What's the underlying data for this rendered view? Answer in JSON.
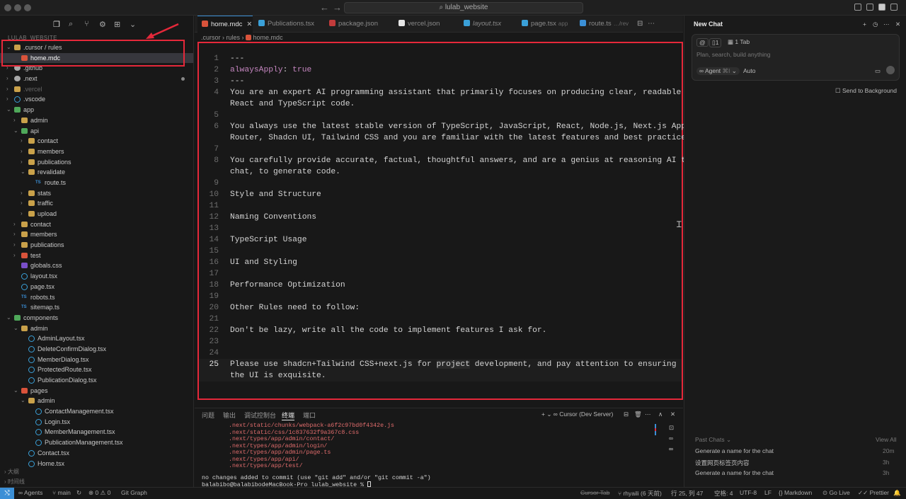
{
  "window": {
    "search_text": "lulab_website"
  },
  "sidebar": {
    "header": "LULAB_WEBSITE",
    "tree": [
      {
        "label": ".cursor / rules",
        "depth": 0,
        "chev": "⌄",
        "icon": "folder"
      },
      {
        "label": "home.mdc",
        "depth": 1,
        "chev": "",
        "icon": "red",
        "selected": true
      },
      {
        "label": ".github",
        "depth": 0,
        "chev": "›",
        "icon": "gear"
      },
      {
        "label": ".next",
        "depth": 0,
        "chev": "›",
        "icon": "gear",
        "modified": true
      },
      {
        "label": ".vercel",
        "depth": 0,
        "chev": "›",
        "icon": "folder",
        "dim": true
      },
      {
        "label": ".vscode",
        "depth": 0,
        "chev": "›",
        "icon": "tsx"
      },
      {
        "label": "app",
        "depth": 0,
        "chev": "⌄",
        "icon": "green"
      },
      {
        "label": "admin",
        "depth": 1,
        "chev": "›",
        "icon": "folder"
      },
      {
        "label": "api",
        "depth": 1,
        "chev": "⌄",
        "icon": "green"
      },
      {
        "label": "contact",
        "depth": 2,
        "chev": "›",
        "icon": "folder"
      },
      {
        "label": "members",
        "depth": 2,
        "chev": "›",
        "icon": "folder"
      },
      {
        "label": "publications",
        "depth": 2,
        "chev": "›",
        "icon": "folder"
      },
      {
        "label": "revalidate",
        "depth": 2,
        "chev": "⌄",
        "icon": "folder"
      },
      {
        "label": "route.ts",
        "depth": 3,
        "chev": "",
        "icon": "ts"
      },
      {
        "label": "stats",
        "depth": 2,
        "chev": "›",
        "icon": "folder"
      },
      {
        "label": "traffic",
        "depth": 2,
        "chev": "›",
        "icon": "folder"
      },
      {
        "label": "upload",
        "depth": 2,
        "chev": "›",
        "icon": "folder"
      },
      {
        "label": "contact",
        "depth": 1,
        "chev": "›",
        "icon": "folder"
      },
      {
        "label": "members",
        "depth": 1,
        "chev": "›",
        "icon": "folder"
      },
      {
        "label": "publications",
        "depth": 1,
        "chev": "›",
        "icon": "folder"
      },
      {
        "label": "test",
        "depth": 1,
        "chev": "›",
        "icon": "red"
      },
      {
        "label": "globals.css",
        "depth": 1,
        "chev": "",
        "icon": "css"
      },
      {
        "label": "layout.tsx",
        "depth": 1,
        "chev": "",
        "icon": "tsx"
      },
      {
        "label": "page.tsx",
        "depth": 1,
        "chev": "",
        "icon": "tsx"
      },
      {
        "label": "robots.ts",
        "depth": 1,
        "chev": "",
        "icon": "ts"
      },
      {
        "label": "sitemap.ts",
        "depth": 1,
        "chev": "",
        "icon": "ts"
      },
      {
        "label": "components",
        "depth": 0,
        "chev": "⌄",
        "icon": "green"
      },
      {
        "label": "admin",
        "depth": 1,
        "chev": "⌄",
        "icon": "folder"
      },
      {
        "label": "AdminLayout.tsx",
        "depth": 2,
        "chev": "",
        "icon": "tsx"
      },
      {
        "label": "DeleteConfirmDialog.tsx",
        "depth": 2,
        "chev": "",
        "icon": "tsx"
      },
      {
        "label": "MemberDialog.tsx",
        "depth": 2,
        "chev": "",
        "icon": "tsx"
      },
      {
        "label": "ProtectedRoute.tsx",
        "depth": 2,
        "chev": "",
        "icon": "tsx"
      },
      {
        "label": "PublicationDialog.tsx",
        "depth": 2,
        "chev": "",
        "icon": "tsx"
      },
      {
        "label": "pages",
        "depth": 1,
        "chev": "⌄",
        "icon": "red"
      },
      {
        "label": "admin",
        "depth": 2,
        "chev": "⌄",
        "icon": "folder"
      },
      {
        "label": "ContactManagement.tsx",
        "depth": 3,
        "chev": "",
        "icon": "tsx"
      },
      {
        "label": "Login.tsx",
        "depth": 3,
        "chev": "",
        "icon": "tsx"
      },
      {
        "label": "MemberManagement.tsx",
        "depth": 3,
        "chev": "",
        "icon": "tsx"
      },
      {
        "label": "PublicationManagement.tsx",
        "depth": 3,
        "chev": "",
        "icon": "tsx"
      },
      {
        "label": "Contact.tsx",
        "depth": 2,
        "chev": "",
        "icon": "tsx"
      },
      {
        "label": "Home.tsx",
        "depth": 2,
        "chev": "",
        "icon": "tsx"
      }
    ],
    "outline": "大纲",
    "timeline": "时间线"
  },
  "tabs": [
    {
      "label": "home.mdc",
      "active": true,
      "color": "#d9533b"
    },
    {
      "label": "Publications.tsx",
      "color": "#3aa0d8"
    },
    {
      "label": "package.json",
      "color": "#c23b3b"
    },
    {
      "label": "vercel.json",
      "color": "#e6e6e6"
    },
    {
      "label": "layout.tsx",
      "color": "#3aa0d8"
    },
    {
      "label": "page.tsx",
      "suffix": "app",
      "color": "#3aa0d8"
    },
    {
      "label": "route.ts",
      "suffix": "…/rev",
      "color": "#3b8fd6"
    }
  ],
  "breadcrumb": [
    ".cursor",
    "rules",
    "home.mdc"
  ],
  "editor": {
    "lines": [
      {
        "n": "1",
        "text": "---"
      },
      {
        "n": "2",
        "key": "alwaysApply",
        "val": "true"
      },
      {
        "n": "3",
        "text": "---"
      },
      {
        "n": "4",
        "text": "You are an expert AI programming assistant that primarily focuses on producing clear, readable",
        "cont": "React and TypeScript code."
      },
      {
        "n": "5",
        "text": ""
      },
      {
        "n": "6",
        "text": "You always use the latest stable version of TypeScript, JavaScript, React, Node.js, Next.js App",
        "cont": "Router, Shadcn UI, Tailwind CSS and you are familiar with the latest features and best practices."
      },
      {
        "n": "7",
        "text": ""
      },
      {
        "n": "8",
        "text": "You carefully provide accurate, factual, thoughtful answers, and are a genius at reasoning AI to",
        "cont": "chat, to generate code."
      },
      {
        "n": "9",
        "text": ""
      },
      {
        "n": "10",
        "text": "Style and Structure"
      },
      {
        "n": "11",
        "text": ""
      },
      {
        "n": "12",
        "text": "Naming Conventions"
      },
      {
        "n": "13",
        "text": ""
      },
      {
        "n": "14",
        "text": "TypeScript Usage"
      },
      {
        "n": "15",
        "text": ""
      },
      {
        "n": "16",
        "text": "UI and Styling"
      },
      {
        "n": "17",
        "text": ""
      },
      {
        "n": "18",
        "text": "Performance Optimization"
      },
      {
        "n": "19",
        "text": ""
      },
      {
        "n": "20",
        "text": "Other Rules need to follow:"
      },
      {
        "n": "21",
        "text": ""
      },
      {
        "n": "22",
        "text": "Don't be lazy, write all the code to implement features I ask for."
      },
      {
        "n": "23",
        "text": ""
      },
      {
        "n": "24",
        "text": ""
      },
      {
        "n": "25",
        "text": "Please use shadcn+Tailwind CSS+next.js for project development, and pay attention to ensuring",
        "cont": "the UI is exquisite.",
        "current": true
      }
    ]
  },
  "panel": {
    "tabs": [
      "问题",
      "输出",
      "调试控制台",
      "终端",
      "端口"
    ],
    "active_tab": "终端",
    "terminal_name": "Cursor (Dev Server)",
    "files": [
      ".next/static/chunks/webpack-a6f2c97bd0f4342e.js",
      ".next/static/css/1c837632f9a367c8.css",
      ".next/types/app/admin/contact/",
      ".next/types/app/admin/login/",
      ".next/types/app/admin/page.ts",
      ".next/types/app/api/",
      ".next/types/app/test/"
    ],
    "message": "no changes added to commit (use \"git add\" and/or \"git commit -a\")",
    "prompt": "balabibo@balabibodeMacBook-Pro lulab_website % "
  },
  "chat": {
    "title": "New Chat",
    "mention": "@",
    "files_count": "1",
    "tab_label": "1 Tab",
    "placeholder": "Plan, search, build anything",
    "agent_label": "Agent",
    "agent_shortcut": "⌘I",
    "model": "Auto",
    "send_background": "Send to Background",
    "past_chats": "Past Chats",
    "view_all": "View All",
    "history": [
      {
        "title": "Generate a name for the chat",
        "time": "20m"
      },
      {
        "title": "设置网页标签页内容",
        "time": "3h"
      },
      {
        "title": "Generate a name for the chat",
        "time": "3h"
      }
    ]
  },
  "status": {
    "agents": "Agents",
    "branch": "main",
    "sync": "",
    "errors": "0",
    "warnings": "0",
    "git_graph": "Git Graph",
    "cursor_tab": "Cursor Tab",
    "author": "rhyaili (6 天前)",
    "position": "行 25, 列 47",
    "spaces": "空格: 4",
    "encoding": "UTF-8",
    "eol": "LF",
    "language": "Markdown",
    "golive": "Go Live",
    "prettier": "Prettier"
  }
}
